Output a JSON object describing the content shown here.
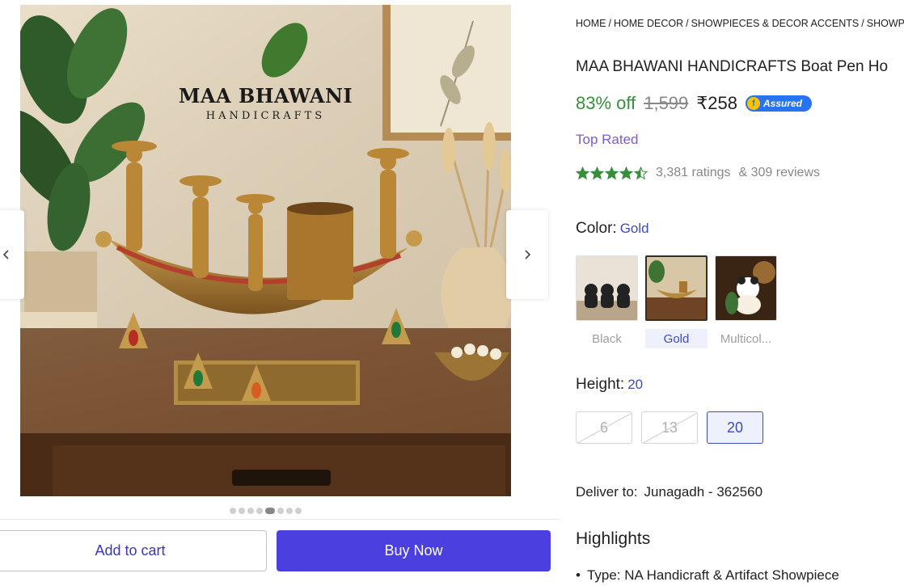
{
  "gallery": {
    "brand_name": "MAA BHAWANI",
    "brand_sub": "HANDICRAFTS",
    "prev_icon": "chevron-left-icon",
    "next_icon": "chevron-right-icon",
    "dot_count": 8,
    "active_dot": 4
  },
  "actions": {
    "add_to_cart": "Add to cart",
    "buy_now": "Buy Now",
    "buy_color": "#4b3fe0"
  },
  "breadcrumb": [
    "HOME",
    "HOME DECOR",
    "SHOWPIECES & DECOR ACCENTS",
    "SHOWP"
  ],
  "product": {
    "title": "MAA BHAWANI HANDICRAFTS Boat Pen Ho",
    "discount": "83% off",
    "mrp": "1,599",
    "price": "₹258",
    "assured": "Assured",
    "badge": "Top Rated",
    "rating_value": 4.5,
    "ratings": "3,381 ratings",
    "reviews": "& 309 reviews"
  },
  "color": {
    "label": "Color:",
    "selected": "Gold",
    "options": [
      {
        "name": "Black",
        "selected": false
      },
      {
        "name": "Gold",
        "selected": true
      },
      {
        "name": "Multicol...",
        "selected": false
      }
    ]
  },
  "height": {
    "label": "Height:",
    "selected": "20",
    "options": [
      {
        "value": "6",
        "available": false
      },
      {
        "value": "13",
        "available": false
      },
      {
        "value": "20",
        "available": true,
        "selected": true
      }
    ]
  },
  "delivery": {
    "label": "Deliver to:",
    "location": "Junagadh - 362560"
  },
  "highlights": {
    "title": "Highlights",
    "items": [
      "Type: NA Handicraft & Artifact Showpiece"
    ]
  },
  "colors": {
    "green": "#388e3c",
    "accent": "#3f4bb8",
    "assured_blue": "#2874f0",
    "top_rated": "#7b5cc9"
  }
}
